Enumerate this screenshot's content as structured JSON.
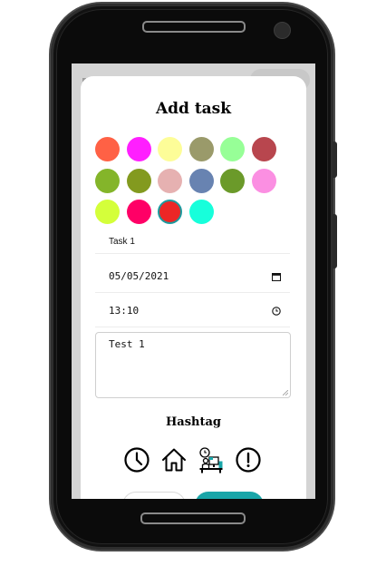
{
  "dialog": {
    "title": "Add task"
  },
  "colors": [
    {
      "name": "color-1",
      "hex": "#ff6145"
    },
    {
      "name": "color-2",
      "hex": "#ff1fff"
    },
    {
      "name": "color-3",
      "hex": "#fdfd98"
    },
    {
      "name": "color-4",
      "hex": "#9a9a6a"
    },
    {
      "name": "color-5",
      "hex": "#97ff97"
    },
    {
      "name": "color-6",
      "hex": "#b8464e"
    },
    {
      "name": "color-7",
      "hex": "#84b52a"
    },
    {
      "name": "color-8",
      "hex": "#839a1f"
    },
    {
      "name": "color-9",
      "hex": "#e6b1b1"
    },
    {
      "name": "color-10",
      "hex": "#6883b1"
    },
    {
      "name": "color-11",
      "hex": "#6b9a2a"
    },
    {
      "name": "color-12",
      "hex": "#fb8fe2"
    },
    {
      "name": "color-13",
      "hex": "#d4ff3a"
    },
    {
      "name": "color-14",
      "hex": "#ff0066"
    },
    {
      "name": "color-15",
      "hex": "#ec2626",
      "selected": true
    },
    {
      "name": "color-16",
      "hex": "#17ffdb"
    }
  ],
  "form": {
    "task_name": "Task 1",
    "date": "05/05/2021",
    "time": "13:10",
    "description": "Test 1"
  },
  "hashtag": {
    "title": "Hashtag",
    "icons": [
      "clock-icon",
      "home-icon",
      "work-desk-icon",
      "alert-icon"
    ]
  },
  "accent_color": "#1aa5a8"
}
